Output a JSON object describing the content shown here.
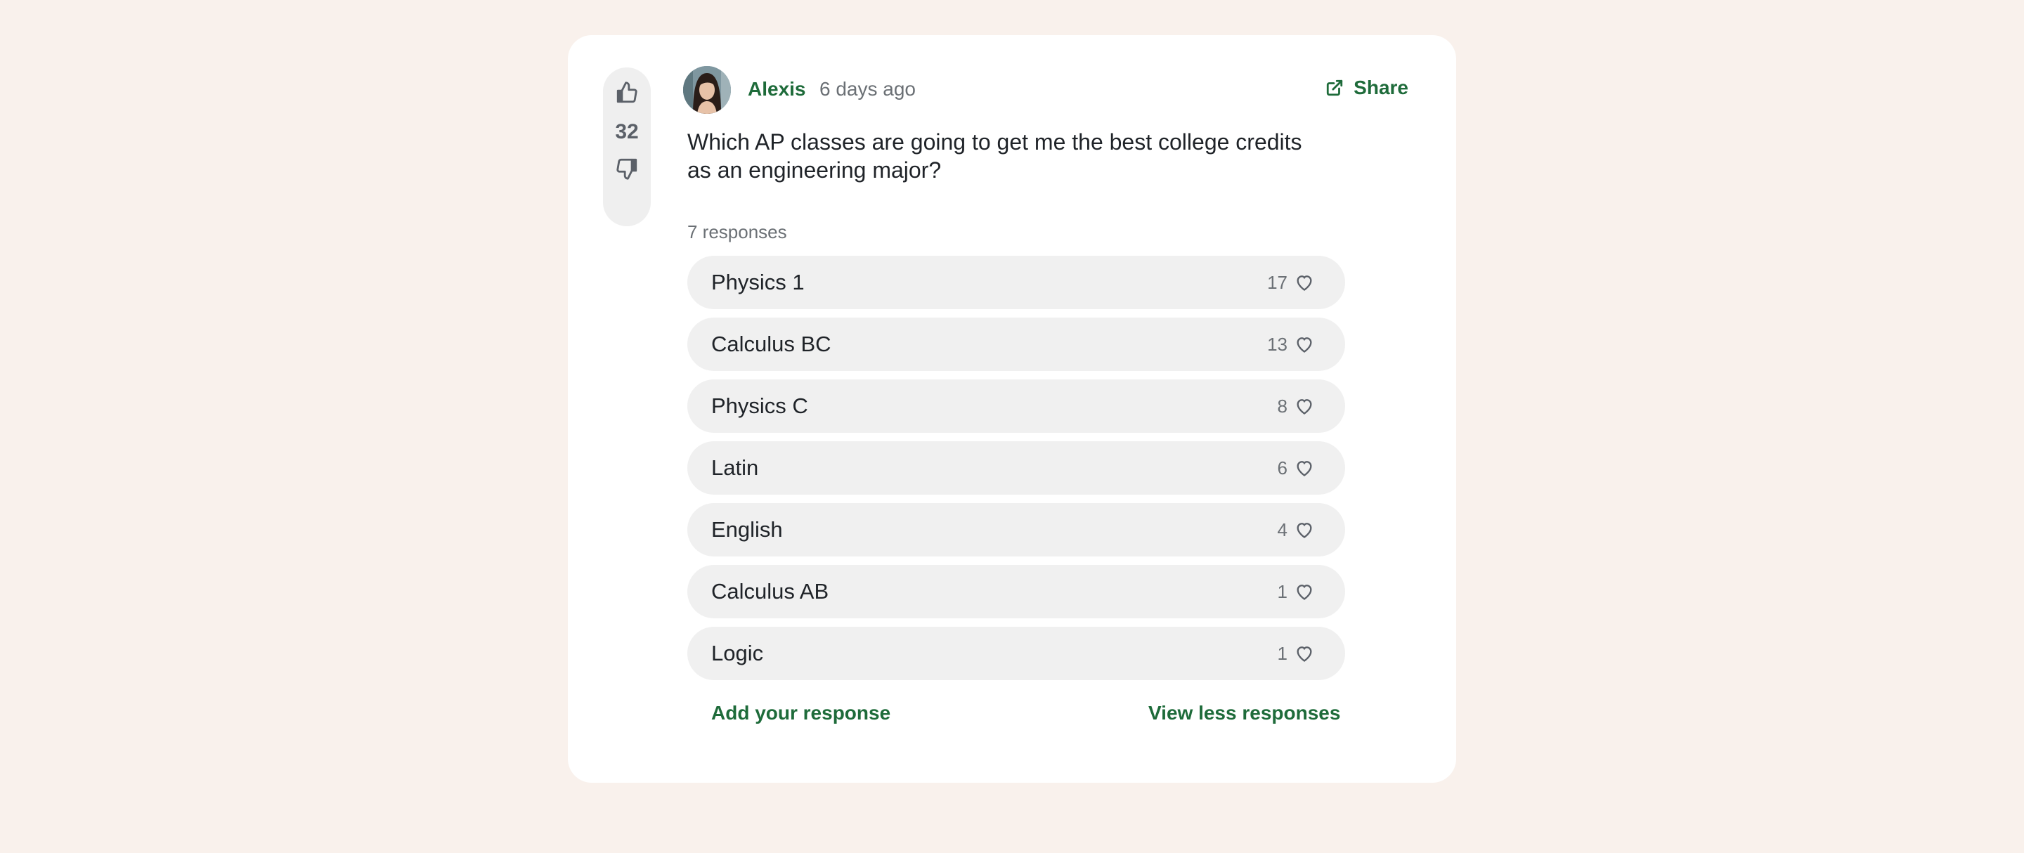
{
  "post": {
    "votes": "32",
    "author": "Alexis",
    "time_ago": "6 days ago",
    "share_label": "Share",
    "question": "Which AP classes are going to get me the best college credits as an engineering major?",
    "responses_count_label": "7 responses",
    "responses": [
      {
        "label": "Physics 1",
        "likes": "17"
      },
      {
        "label": "Calculus BC",
        "likes": "13"
      },
      {
        "label": "Physics C",
        "likes": "8"
      },
      {
        "label": "Latin",
        "likes": "6"
      },
      {
        "label": "English",
        "likes": "4"
      },
      {
        "label": "Calculus AB",
        "likes": "1"
      },
      {
        "label": "Logic",
        "likes": "1"
      }
    ],
    "add_response_label": "Add your response",
    "view_less_label": "View less responses"
  },
  "colors": {
    "page_bg": "#f9f1ec",
    "accent_green": "#1e6b3a",
    "pill_bg": "#f0f0f0",
    "muted_text": "#6b7075"
  },
  "icons": {
    "upvote": "thumbs-up-icon",
    "downvote": "thumbs-down-icon",
    "share": "external-link-icon",
    "like": "heart-icon"
  }
}
